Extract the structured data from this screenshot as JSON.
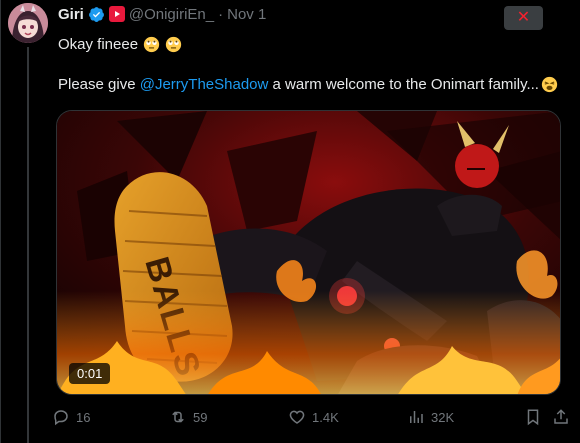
{
  "tweet": {
    "author_name": "Giri",
    "handle": "@OnigiriEn_",
    "separator": "·",
    "date": "Nov 1",
    "line1": "Okay fineee",
    "line2_prefix": "Please give ",
    "mention": "@JerryTheShadow",
    "line2_suffix": " a warm welcome to the Onimart family...",
    "media_artwork_text": "BALLS",
    "video_duration": "0:01"
  },
  "actions": {
    "replies": "16",
    "reposts": "59",
    "likes": "1.4K",
    "views": "32K"
  },
  "colors": {
    "accent": "#1d9bf0",
    "close": "#f4212e",
    "muted": "#71767b"
  },
  "icons": [
    "avatar",
    "verified-icon",
    "youtube-badge-icon",
    "close-icon",
    "rolling-eyes-emoji",
    "tired-face-emoji",
    "reply-icon",
    "repost-icon",
    "like-icon",
    "views-icon",
    "bookmark-icon"
  ]
}
